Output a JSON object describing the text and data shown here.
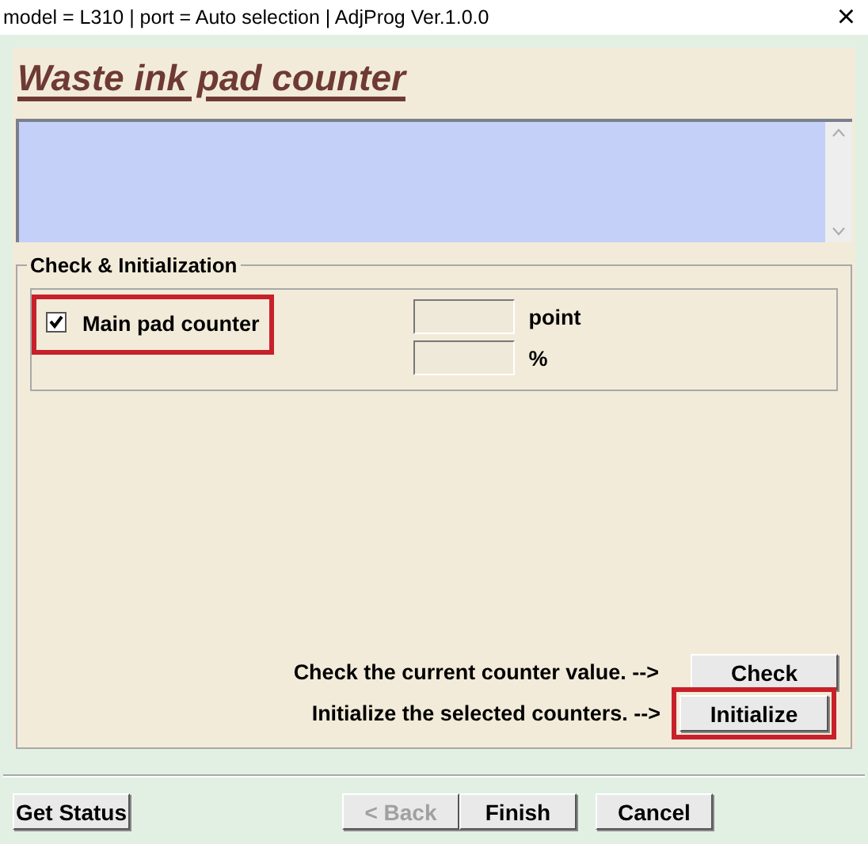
{
  "window": {
    "title": "model = L310 | port = Auto selection | AdjProg Ver.1.0.0",
    "close": "×"
  },
  "heading": "Waste ink pad counter",
  "group": {
    "label": "Check & Initialization",
    "counters": [
      {
        "label": "Main pad counter",
        "checked": true,
        "highlighted": true
      }
    ],
    "fields": [
      {
        "unit": "point"
      },
      {
        "unit": "%"
      }
    ]
  },
  "actions": [
    {
      "prompt": "Check the current counter value. -->",
      "button": "Check",
      "highlighted": false
    },
    {
      "prompt": "Initialize the selected counters. -->",
      "button": "Initialize",
      "highlighted": true
    }
  ],
  "footer": [
    {
      "label": "Get Status",
      "disabled": false
    },
    {
      "label": "< Back",
      "disabled": true
    },
    {
      "label": "Finish",
      "disabled": false
    },
    {
      "label": "Cancel",
      "disabled": false
    }
  ]
}
